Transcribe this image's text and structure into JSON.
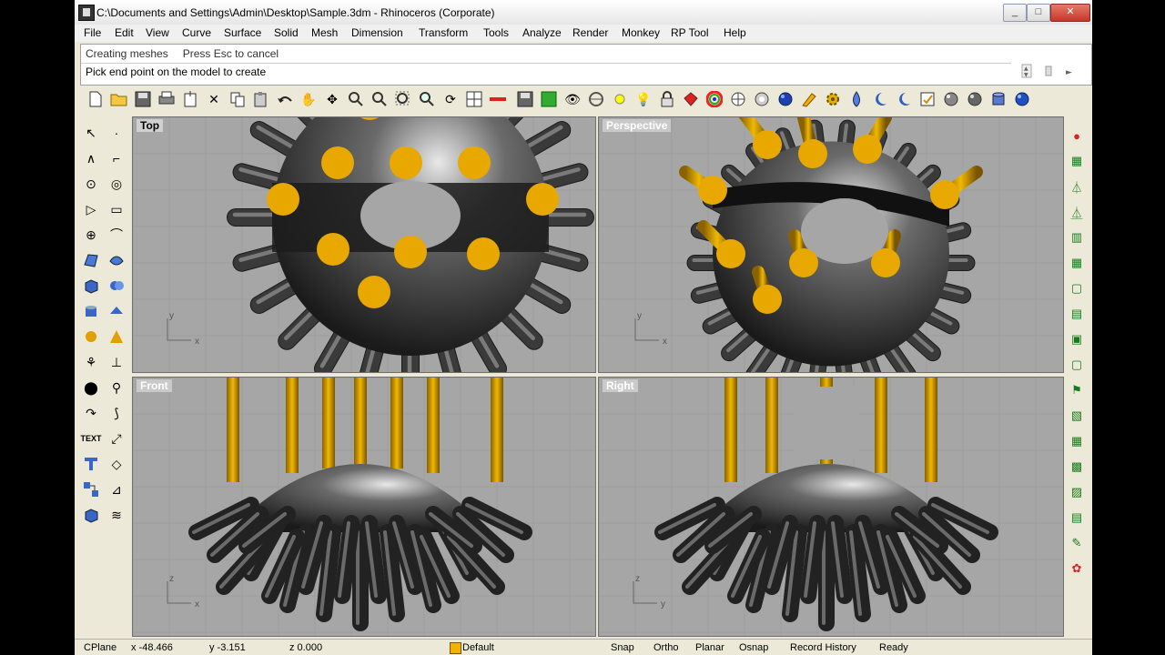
{
  "window": {
    "title": "C:\\Documents and Settings\\Admin\\Desktop\\Sample.3dm - Rhinoceros (Corporate)",
    "controls": {
      "minimize": "_",
      "maximize": "□",
      "close": "✕"
    }
  },
  "menu": [
    "File",
    "Edit",
    "View",
    "Curve",
    "Surface",
    "Solid",
    "Mesh",
    "Dimension",
    "Transform",
    "Tools",
    "Analyze",
    "Render",
    "Monkey",
    "RP Tool",
    "Help"
  ],
  "command": {
    "history_a": "Creating meshes",
    "history_b": "Press Esc to cancel",
    "prompt": "Pick end point on the model to create"
  },
  "toolbar_icons": [
    "new-file-icon",
    "open-icon",
    "save-icon",
    "print-icon",
    "import-icon",
    "cut-icon",
    "copy-icon",
    "paste-icon",
    "undo-icon",
    "pan-hand-icon",
    "move-view-icon",
    "zoom-icon",
    "zoom-window-icon",
    "zoom-extents-icon",
    "zoom-selected-icon",
    "rotate-view-icon",
    "four-viewports-icon",
    "set-cplane-icon",
    "save-small-icon",
    "layer-icon",
    "show-icon",
    "select-icon",
    "osnap-icon",
    "light-icon",
    "lock-icon",
    "material-icon",
    "color-wheel-icon",
    "render-sphere-icon",
    "render-sphere-icon-2",
    "blue-sphere-icon",
    "paint-icon",
    "gear-icon",
    "render-drop-icon",
    "moon-icon",
    "moon-icon-2",
    "properties-icon",
    "gray-sphere-icon",
    "gray-sphere-icon-2",
    "cylinder-icon",
    "blue-ball-icon"
  ],
  "viewports": {
    "top": "Top",
    "perspective": "Perspective",
    "front": "Front",
    "right": "Right"
  },
  "axes": {
    "x": "x",
    "y": "y",
    "z": "z"
  },
  "status": {
    "cplane": "CPlane",
    "x": "x -48.466",
    "y": "y -3.151",
    "z": "z 0.000",
    "layer": "Default",
    "snap": "Snap",
    "ortho": "Ortho",
    "planar": "Planar",
    "osnap": "Osnap",
    "record": "Record History",
    "ready": "Ready"
  },
  "colors": {
    "accent_yellow": "#e8a800",
    "layer_swatch": "#f0b400"
  }
}
